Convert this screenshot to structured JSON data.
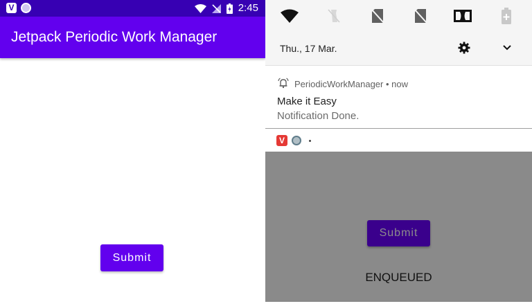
{
  "left_screen": {
    "status_bar": {
      "time": "2:45",
      "app_icon_letter": "V",
      "background": "#3700b3"
    },
    "app_bar": {
      "title": "Jetpack Periodic Work Manager",
      "background": "#6200ee"
    },
    "submit_label": "Submit",
    "accent": "#6200ee"
  },
  "right_screen": {
    "quick_settings": {
      "tiles": [
        "wifi-icon",
        "flashlight-off-icon",
        "no-sim-icon",
        "no-sim-icon",
        "dolby-icon",
        "battery-saver-icon"
      ],
      "date": "Thu., 17 Mar."
    },
    "notification": {
      "app_name": "PeriodicWorkManager • now",
      "title": "Make it Easy",
      "text": "Notification Done."
    },
    "mini_icons": {
      "app_icon_letter": "V"
    },
    "app": {
      "submit_label": "Submit",
      "status_text": "ENQUEUED",
      "dim_color": "#8a8a8a"
    }
  }
}
